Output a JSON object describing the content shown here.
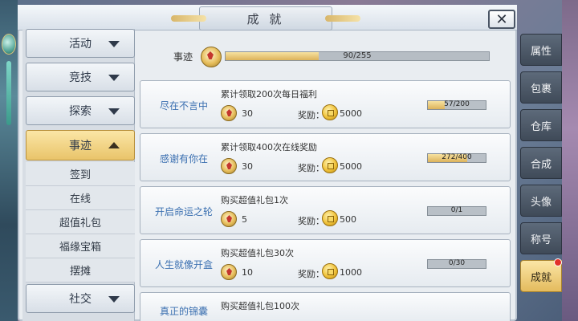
{
  "header": {
    "title": "成 就",
    "close_label": "✕"
  },
  "left_menu": {
    "items": [
      {
        "label": "活动",
        "active": false
      },
      {
        "label": "竞技",
        "active": false
      },
      {
        "label": "探索",
        "active": false
      },
      {
        "label": "事迹",
        "active": true
      },
      {
        "label": "社交",
        "active": false
      }
    ],
    "sub_items": [
      "签到",
      "在线",
      "超值礼包",
      "福缘宝箱",
      "摆摊"
    ]
  },
  "overall": {
    "label": "事迹",
    "progress_text": "90/255",
    "progress": 0.353
  },
  "achievements": [
    {
      "name": "尽在不言中",
      "desc": "累计领取200次每日福利",
      "points": "30",
      "reward_label": "奖励：",
      "reward": "5000",
      "progress_text": "57/200",
      "progress": 0.285
    },
    {
      "name": "感谢有你在",
      "desc": "累计领取400次在线奖励",
      "points": "30",
      "reward_label": "奖励：",
      "reward": "5000",
      "progress_text": "272/400",
      "progress": 0.68
    },
    {
      "name": "开启命运之轮",
      "desc": "购买超值礼包1次",
      "points": "5",
      "reward_label": "奖励：",
      "reward": "500",
      "progress_text": "0/1",
      "progress": 0
    },
    {
      "name": "人生就像开盒",
      "desc": "购买超值礼包30次",
      "points": "10",
      "reward_label": "奖励：",
      "reward": "1000",
      "progress_text": "0/30",
      "progress": 0
    },
    {
      "name": "真正的锦囊",
      "desc": "购买超值礼包100次",
      "points": "",
      "reward_label": "",
      "reward": "",
      "progress_text": "",
      "progress": 0
    }
  ],
  "right_tabs": [
    {
      "label": "属性",
      "active": false
    },
    {
      "label": "包裹",
      "active": false
    },
    {
      "label": "仓库",
      "active": false
    },
    {
      "label": "合成",
      "active": false
    },
    {
      "label": "头像",
      "active": false
    },
    {
      "label": "称号",
      "active": false
    },
    {
      "label": "成就",
      "active": true
    }
  ],
  "colors": {
    "accent_gold": "#e4bb5e",
    "name_blue": "#3a6fb0",
    "notify_red": "#e2312a"
  }
}
